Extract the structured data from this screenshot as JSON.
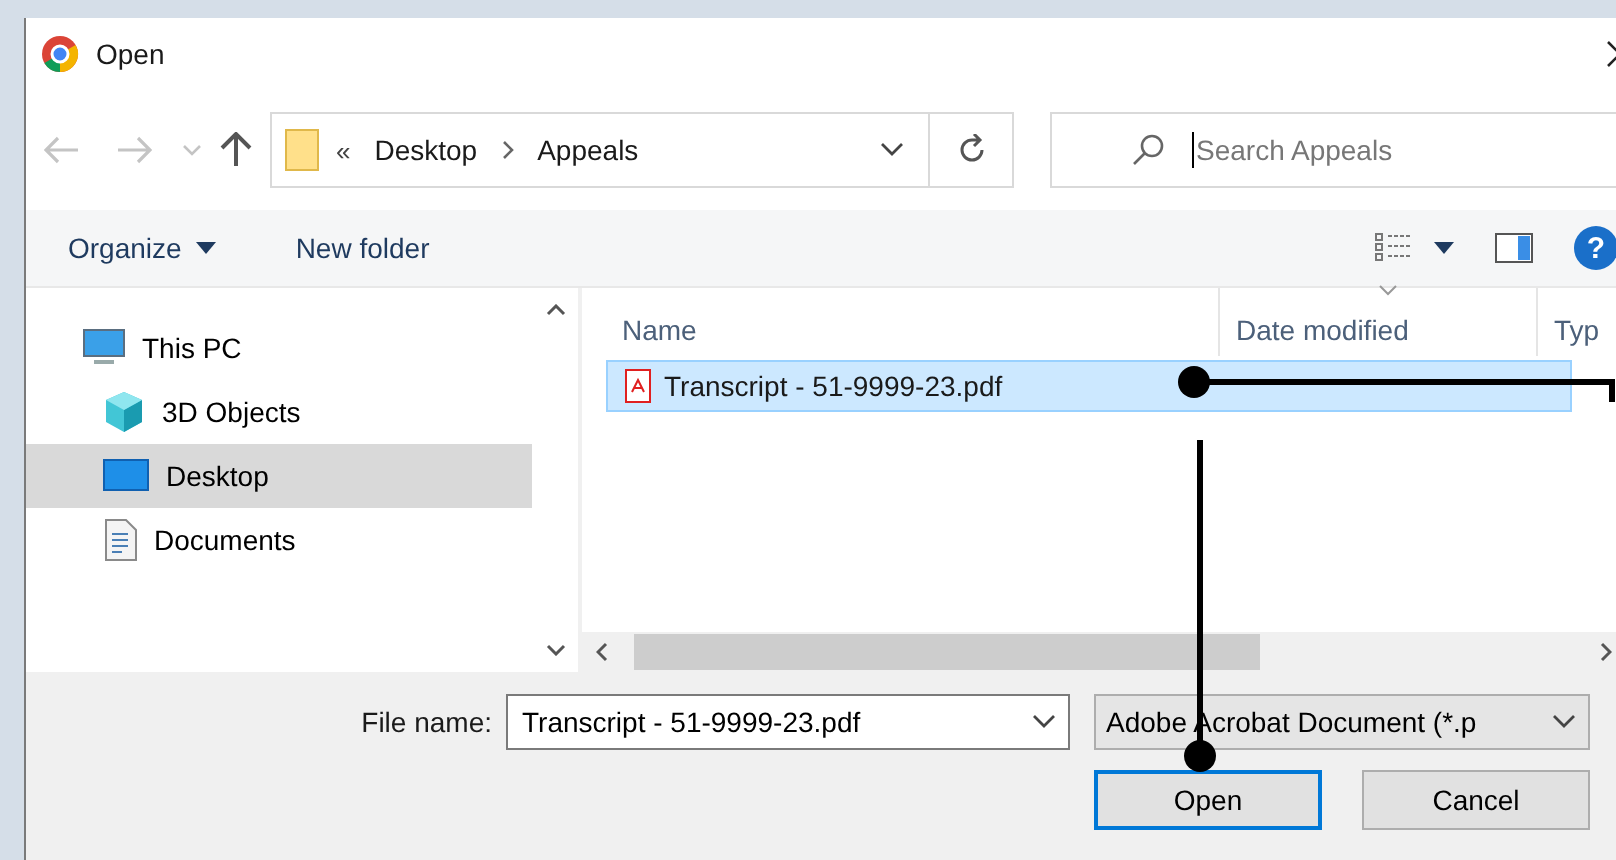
{
  "window": {
    "title": "Open"
  },
  "nav_buttons": [
    {
      "kind": "back",
      "disabled": true
    },
    {
      "kind": "forward",
      "disabled": true
    },
    {
      "kind": "recent",
      "disabled": true
    },
    {
      "kind": "up",
      "disabled": false
    }
  ],
  "address_bar": {
    "overflow": "«",
    "crumbs": [
      "Desktop",
      "Appeals"
    ]
  },
  "search": {
    "placeholder": "Search Appeals"
  },
  "toolbar": {
    "organize": "Organize",
    "new_folder": "New folder",
    "help": "?"
  },
  "sidebar": {
    "items": [
      {
        "label": "This PC",
        "kind": "pc",
        "selected": false
      },
      {
        "label": "3D Objects",
        "kind": "cube",
        "selected": false
      },
      {
        "label": "Desktop",
        "kind": "desktop",
        "selected": true
      },
      {
        "label": "Documents",
        "kind": "docs",
        "selected": false
      }
    ]
  },
  "file_list": {
    "columns": [
      {
        "label": "Name",
        "sorted": false
      },
      {
        "label": "Date modified",
        "sorted": true
      },
      {
        "label": "Typ",
        "sorted": false
      }
    ],
    "rows": [
      {
        "name": "Transcript - 51-9999-23.pdf",
        "selected": true
      }
    ]
  },
  "footer": {
    "file_name_label": "File name:",
    "file_name": "Transcript - 51-9999-23.pdf",
    "file_type": "Adobe Acrobat Document (*.p",
    "buttons": [
      {
        "label": "Open",
        "default": true
      },
      {
        "label": "Cancel",
        "default": false
      }
    ]
  }
}
